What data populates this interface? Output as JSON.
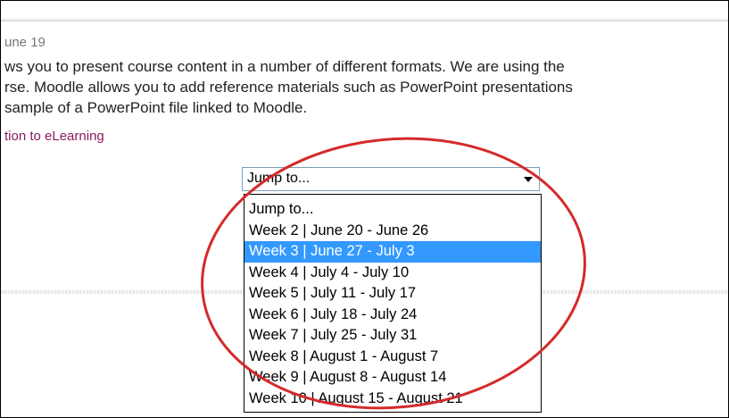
{
  "section": {
    "date_text": "une 19",
    "summary_lines": [
      "ws you to present course content in a number of different formats. We are using the",
      "rse. Moodle allows you to add reference materials such as PowerPoint presentations",
      "sample of a PowerPoint file linked to Moodle."
    ],
    "link_text": "tion to eLearning"
  },
  "jump_select": {
    "current_value": "Jump to...",
    "options": [
      "Jump to...",
      "Week 2 | June 20 - June 26",
      "Week 3 | June 27 - July 3",
      "Week 4 | July 4 - July 10",
      "Week 5 | July 11 - July 17",
      "Week 6 | July 18 - July 24",
      "Week 7 | July 25 - July 31",
      "Week 8 | August 1 - August 7",
      "Week 9 | August 8 - August 14",
      "Week 10 | August 15 - August 21"
    ],
    "highlighted_option": "Week 3 | June 27 - July 3"
  },
  "colors": {
    "link": "#8b1b5e",
    "highlight": "#3399ff",
    "annotation_circle": "#d42a2a"
  },
  "icons": {
    "dropdown_arrow": "chevron-down-icon"
  }
}
